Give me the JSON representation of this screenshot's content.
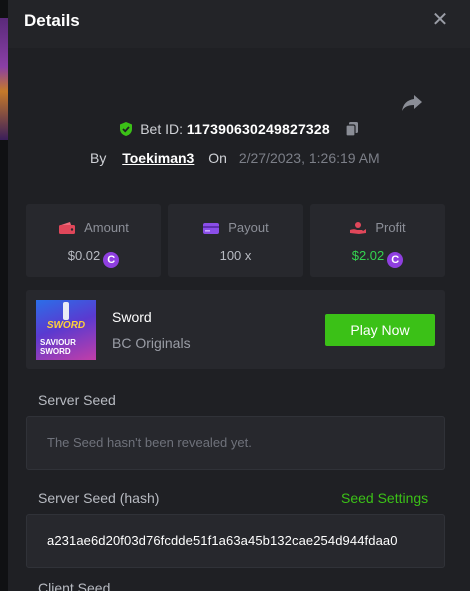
{
  "header": {
    "title": "Details",
    "close_glyph": "✕"
  },
  "bet": {
    "id_label": "Bet ID:",
    "id_value": "117390630249827328",
    "by_label": "By",
    "user": "Toekiman3",
    "on_label": "On",
    "datetime": "2/27/2023, 1:26:19 AM"
  },
  "stats": {
    "amount": {
      "label": "Amount",
      "value": "$0.02",
      "icon": "wallet-icon"
    },
    "payout": {
      "label": "Payout",
      "value": "100 x",
      "icon": "card-icon"
    },
    "profit": {
      "label": "Profit",
      "value": "$2.02",
      "icon": "hand-coin-icon"
    }
  },
  "coin_glyph": "C",
  "game": {
    "name": "Sword",
    "provider": "BC Originals",
    "play_label": "Play Now",
    "thumb_title": "SWORD",
    "thumb_sub": "SAVIOUR SWORD"
  },
  "server_seed": {
    "label": "Server Seed",
    "message": "The Seed hasn't been revealed yet."
  },
  "server_hash": {
    "label": "Server Seed (hash)",
    "settings_label": "Seed Settings",
    "value": "a231ae6d20f03d76fcdde51f1a63a45b132cae254d944fdaa0"
  },
  "client_seed": {
    "label": "Client Seed"
  },
  "colors": {
    "accent_green": "#3bc117",
    "profit_green": "#34d34f",
    "coin_purple": "#8f3fe0",
    "panel": "#1f2024"
  }
}
